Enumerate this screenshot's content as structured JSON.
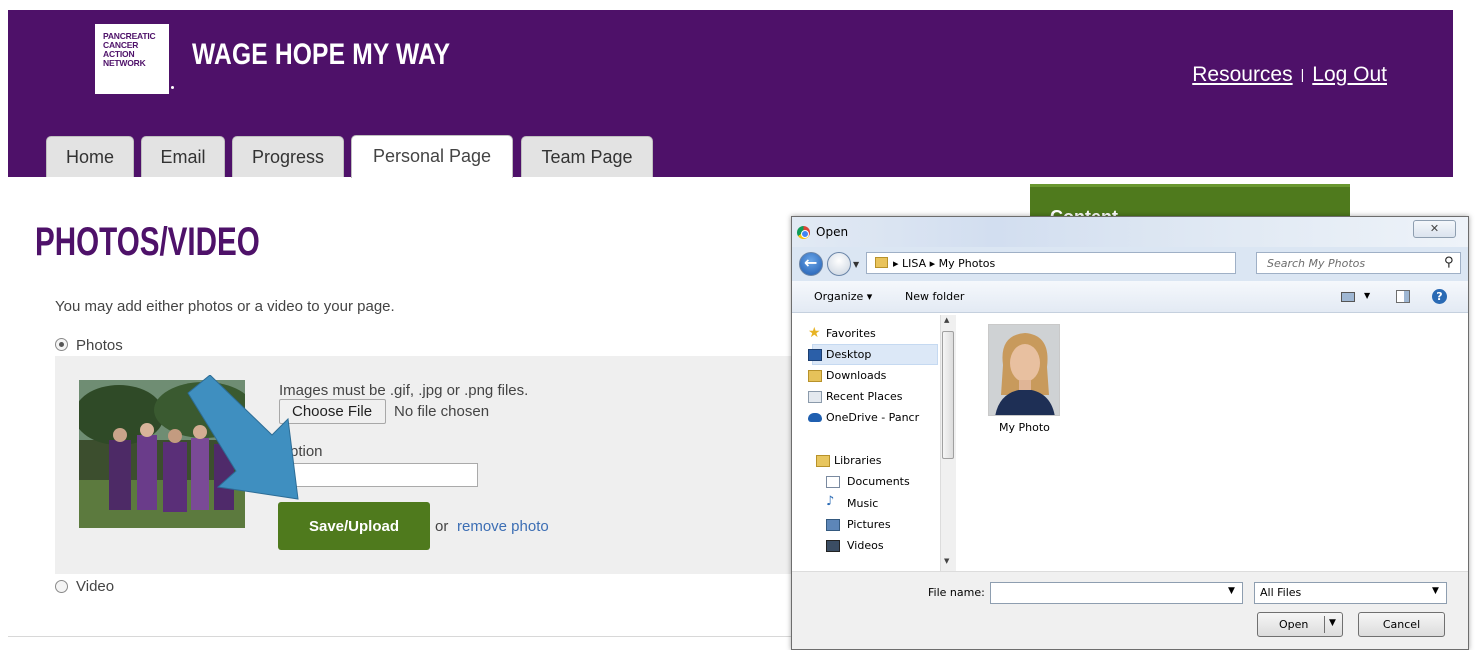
{
  "header": {
    "logo_lines": [
      "PANCREATIC",
      "CANCER",
      "ACTION",
      "NETWORK"
    ],
    "site_title": "WAGE HOPE MY WAY",
    "resources_link": "Resources",
    "separator": "|",
    "logout_link": "Log Out"
  },
  "tabs": [
    {
      "label": "Home",
      "active": false
    },
    {
      "label": "Email",
      "active": false
    },
    {
      "label": "Progress",
      "active": false
    },
    {
      "label": "Personal Page",
      "active": true
    },
    {
      "label": "Team Page",
      "active": false
    }
  ],
  "main": {
    "title": "PHOTOS/VIDEO",
    "intro": "You may add either photos or a video to your page.",
    "photos_option": "Photos",
    "video_option": "Video",
    "selected_option": "Photos",
    "image_rule": "Images must be .gif, .jpg or .png files.",
    "choose_file_label": "Choose File",
    "no_file_text": "No file chosen",
    "caption_label": "ption",
    "caption_value": "",
    "save_button": "Save/Upload",
    "or_text": "or",
    "remove_link": "remove photo"
  },
  "side_box": {
    "label": "Content"
  },
  "dialog": {
    "title": "Open",
    "close_glyph": "✕",
    "path": [
      "LISA",
      "My Photos"
    ],
    "search_placeholder": "Search My Photos",
    "organize_label": "Organize ▾",
    "new_folder_label": "New folder",
    "nav_items": [
      {
        "label": "Favorites",
        "icon": "star-icon"
      },
      {
        "label": "Desktop",
        "icon": "desktop-icon",
        "selected": true
      },
      {
        "label": "Downloads",
        "icon": "downloads-icon"
      },
      {
        "label": "Recent Places",
        "icon": "recent-places-icon"
      },
      {
        "label": "OneDrive - Pancr",
        "icon": "onedrive-icon"
      },
      {
        "label": "Libraries",
        "icon": "libraries-icon"
      },
      {
        "label": "Documents",
        "icon": "documents-icon"
      },
      {
        "label": "Music",
        "icon": "music-icon"
      },
      {
        "label": "Pictures",
        "icon": "pictures-icon"
      },
      {
        "label": "Videos",
        "icon": "videos-icon"
      }
    ],
    "file_item": "My Photo",
    "file_name_label": "File name:",
    "file_name_value": "",
    "file_type": "All Files",
    "open_button": "Open",
    "cancel_button": "Cancel"
  },
  "colors": {
    "brand_purple": "#4e1169",
    "action_green": "#4f7a1d",
    "arrow_blue": "#3f8fc0",
    "link_blue": "#3c6eb4"
  }
}
